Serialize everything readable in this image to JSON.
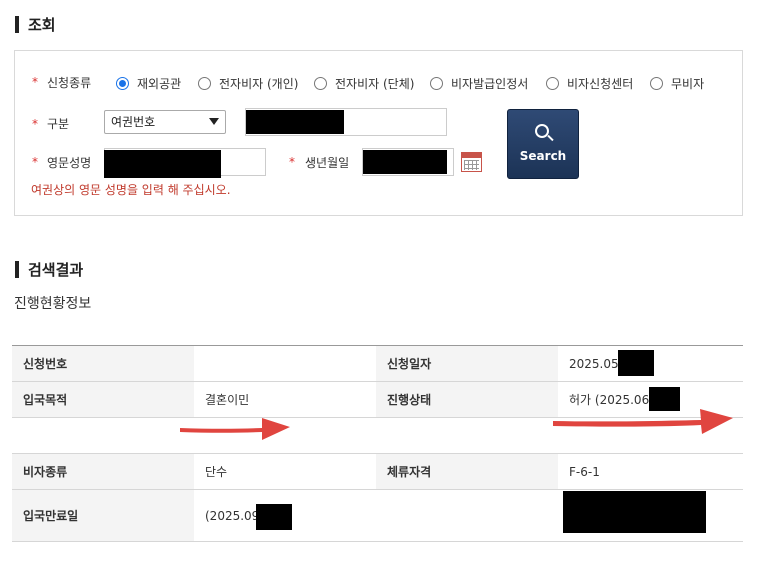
{
  "inquiry": {
    "title": "조회",
    "fields": {
      "application_type_label": "신청종류",
      "category_label": "구분",
      "english_name_label": "영문성명",
      "birthdate_label": "생년월일"
    },
    "radio_options": [
      {
        "label": "재외공관",
        "selected": true
      },
      {
        "label": "전자비자 (개인)",
        "selected": false
      },
      {
        "label": "전자비자 (단체)",
        "selected": false
      },
      {
        "label": "비자발급인정서",
        "selected": false
      },
      {
        "label": "비자신청센터",
        "selected": false
      },
      {
        "label": "무비자",
        "selected": false
      }
    ],
    "category_select_value": "여권번호",
    "hint": "여권상의 영문 성명을 입력 해 주십시오.",
    "search_button": "Search",
    "required_mark": "*"
  },
  "results": {
    "title": "검색결과",
    "subtitle": "진행현황정보",
    "rows": [
      {
        "h1": "신청번호",
        "v1": "",
        "h2": "신청일자",
        "v2": "2025.05"
      },
      {
        "h1": "입국목적",
        "v1": "결혼이민",
        "h2": "진행상태",
        "v2": "허가 (2025.06."
      },
      {
        "h1": "비자종류",
        "v1": "단수",
        "h2": "체류자격",
        "v2": "F-6-1"
      },
      {
        "h1": "입국만료일",
        "v1": "(2025.09",
        "h2": "",
        "v2": ""
      }
    ]
  },
  "colors": {
    "accent_radio": "#1a73e8",
    "required": "#d9302f",
    "search_button": "#1c3356",
    "annotation_arrow": "#e0453f"
  }
}
